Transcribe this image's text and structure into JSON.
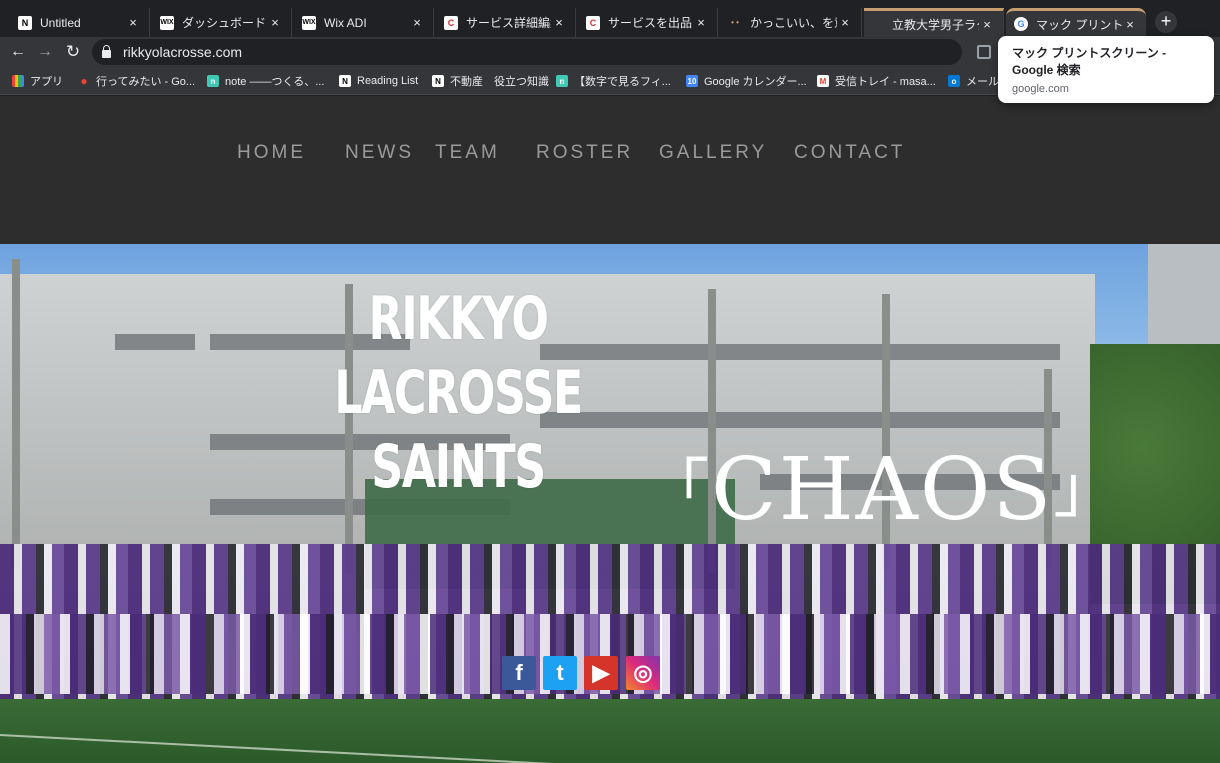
{
  "browser": {
    "tabs": [
      {
        "title": "Untitled",
        "favicon": "notion-icon"
      },
      {
        "title": "ダッシュボード | W",
        "favicon": "wix-icon"
      },
      {
        "title": "Wix ADI",
        "favicon": "wix-icon"
      },
      {
        "title": "サービス詳細編集 |",
        "favicon": "coconala-icon"
      },
      {
        "title": "サービスを出品した",
        "favicon": "coconala-icon"
      },
      {
        "title": "かっこいい、を意味",
        "favicon": "dots-icon"
      },
      {
        "title": "立教大学男子ラク",
        "favicon": "none"
      },
      {
        "title": "マック プリントス",
        "favicon": "google-icon"
      }
    ],
    "close_glyph": "×",
    "new_tab_glyph": "+",
    "url": "rikkyolacrosse.com",
    "back_glyph": "←",
    "forward_glyph": "→",
    "reload_glyph": "↻",
    "bookmarks": [
      {
        "label": "アプリ",
        "icon": "apps-grid-icon"
      },
      {
        "label": "行ってみたい - Go...",
        "icon": "maps-pin-icon"
      },
      {
        "label": "note ——つくる、...",
        "icon": "note-icon"
      },
      {
        "label": "Reading List",
        "icon": "notion-icon"
      },
      {
        "label": "不動産　役立つ知識",
        "icon": "notion-icon"
      },
      {
        "label": "【数字で見るフィ...",
        "icon": "note-icon"
      },
      {
        "label": "Google カレンダー...",
        "icon": "calendar-icon"
      },
      {
        "label": "受信トレイ - masa...",
        "icon": "gmail-icon"
      },
      {
        "label": "メール",
        "icon": "outlook-icon"
      }
    ],
    "tooltip": {
      "title": "マック プリントスクリーン - Google 検索",
      "domain": "google.com"
    }
  },
  "site": {
    "nav": [
      "HOME",
      "NEWS",
      "TEAM",
      "ROSTER",
      "GALLERY",
      "CONTACT"
    ],
    "hero_title_line1": "RIKKYO LACROSSE",
    "hero_title_line2": "SAINTS",
    "tagline_open": "「",
    "tagline": "CHAOS",
    "tagline_close": "」",
    "social": [
      {
        "name": "facebook",
        "glyph": "f"
      },
      {
        "name": "twitter",
        "glyph": "t"
      },
      {
        "name": "youtube",
        "glyph": "▶"
      },
      {
        "name": "instagram",
        "glyph": "◎"
      }
    ]
  },
  "colors": {
    "site_header_bg": "#2d2d2d",
    "nav_text": "#9a9a9a",
    "facebook": "#3b5998",
    "twitter": "#1da1f2",
    "youtube": "#d5342a"
  }
}
